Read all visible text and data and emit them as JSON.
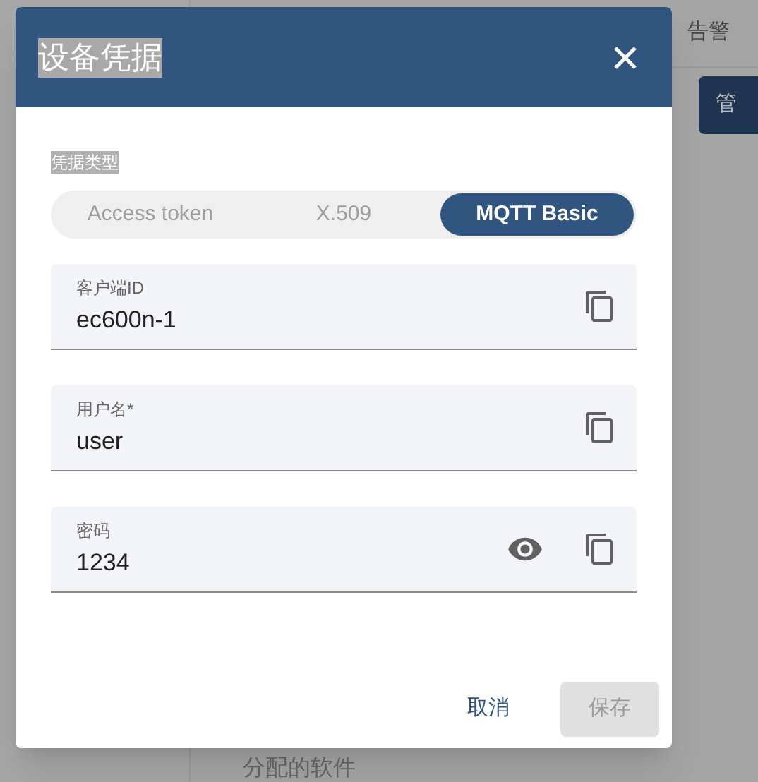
{
  "background": {
    "tab": "告警",
    "button": "管",
    "section": "分配的软件"
  },
  "dialog": {
    "title": "设备凭据",
    "type_label": "凭据类型",
    "types": [
      {
        "label": "Access token",
        "selected": false
      },
      {
        "label": "X.509",
        "selected": false
      },
      {
        "label": "MQTT Basic",
        "selected": true
      }
    ],
    "fields": [
      {
        "label": "客户端ID",
        "value": "ec600n-1",
        "kind": "text"
      },
      {
        "label": "用户名*",
        "value": "user",
        "kind": "text"
      },
      {
        "label": "密码",
        "value": "1234",
        "kind": "password"
      }
    ],
    "actions": [
      {
        "label": "取消",
        "kind": "text",
        "disabled": false
      },
      {
        "label": "保存",
        "kind": "filled",
        "disabled": true
      }
    ]
  }
}
